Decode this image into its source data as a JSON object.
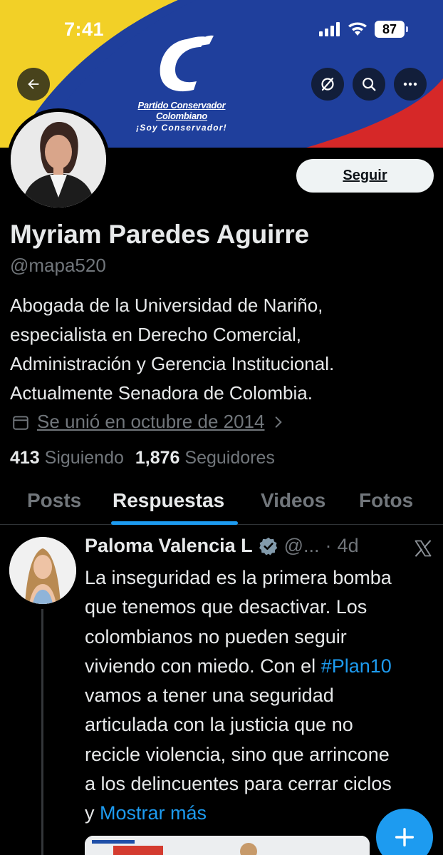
{
  "status_bar": {
    "time": "7:41",
    "battery": "87"
  },
  "banner": {
    "logo_line1": "Partido Conservador Colombiano",
    "logo_line2": "¡Soy Conservador!"
  },
  "profile": {
    "name": "Myriam Paredes Aguirre",
    "handle": "@mapa520",
    "bio_lines": [
      "Abogada de la Universidad de Nariño,",
      "especialista en Derecho Comercial,",
      "Administración y Gerencia Institucional.",
      "Actualmente Senadora de Colombia."
    ],
    "joined": "Se unió en octubre de 2014",
    "following_count": "413",
    "following_label": "Siguiendo",
    "followers_count": "1,876",
    "followers_label": "Seguidores",
    "follow_button": "Seguir"
  },
  "tabs": [
    {
      "label": "Posts",
      "active": false
    },
    {
      "label": "Respuestas",
      "active": true
    },
    {
      "label": "Videos",
      "active": false
    },
    {
      "label": "Fotos",
      "active": false
    }
  ],
  "post": {
    "author": "Paloma Valencia L",
    "handle_truncated": "@...",
    "separator": "·",
    "age": "4d",
    "text_lines": [
      "La inseguridad es la primera bomba",
      "que tenemos que desactivar. Los",
      "colombianos no pueden seguir",
      "viviendo con miedo. Con el "
    ],
    "hashtag": "#Plan10",
    "text_lines_2": [
      "vamos a tener una seguridad",
      "articulada con la justicia que no",
      "recicle violencia, sino que arrincone",
      "a los delincuentes para cerrar ciclos",
      "y "
    ],
    "show_more": "Mostrar más"
  },
  "colors": {
    "accent": "#1d9bf0",
    "background": "#000000",
    "banner_blue": "#1f3f9c",
    "banner_yellow": "#f2d027",
    "banner_red": "#d62828"
  },
  "icons": {
    "back": "arrow-left-icon",
    "grok": "grok-icon",
    "search": "search-icon",
    "more": "more-icon",
    "calendar": "calendar-icon",
    "verified": "verified-badge-icon",
    "x_logo": "x-logo-icon",
    "compose": "plus-icon"
  }
}
